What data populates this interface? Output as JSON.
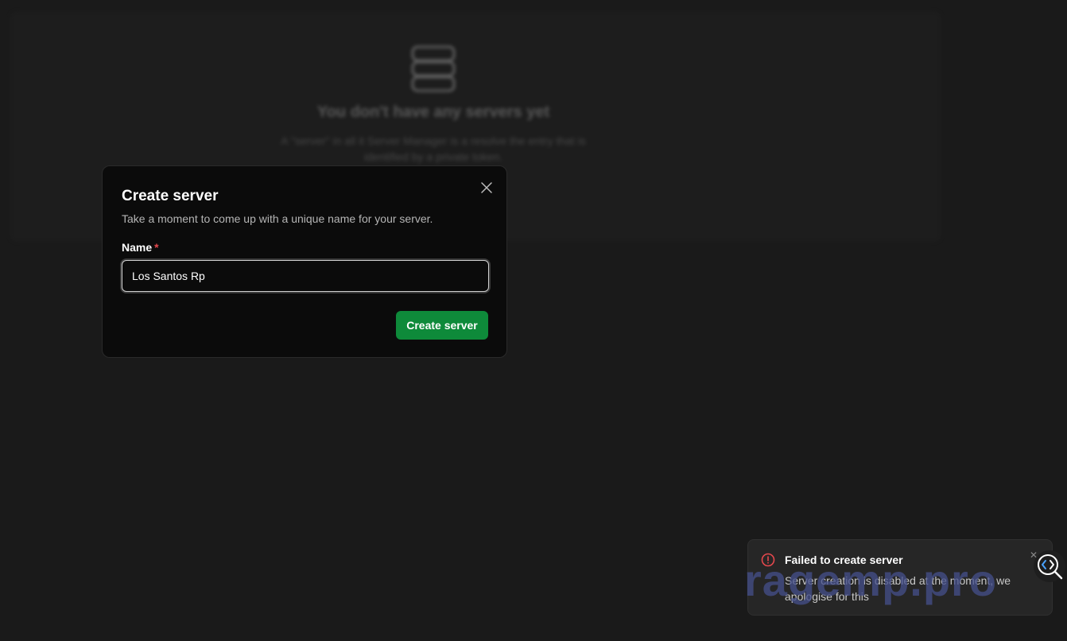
{
  "background": {
    "empty_title": "You don't have any servers yet",
    "empty_description": "A \"server\" in all it Server Manager is a resolve the entry that is identified by a private token."
  },
  "modal": {
    "title": "Create server",
    "subtitle": "Take a moment to come up with a unique name for your server.",
    "name_label": "Name",
    "required_marker": "*",
    "name_value": "Los Santos Rp",
    "submit_label": "Create server"
  },
  "toast": {
    "title": "Failed to create server",
    "description": "Server creation is disabled at the moment, we apologise for this"
  },
  "watermark": "ragemp.pro",
  "colors": {
    "accent": "#0e8a3a",
    "error": "#e5484d",
    "modal_bg": "#0b0b0b",
    "page_bg": "#1a1a1a"
  },
  "icons": {
    "empty_state": "server-stack-icon",
    "close": "close-icon",
    "error": "alert-circle-icon",
    "inspect": "code-search-icon"
  }
}
